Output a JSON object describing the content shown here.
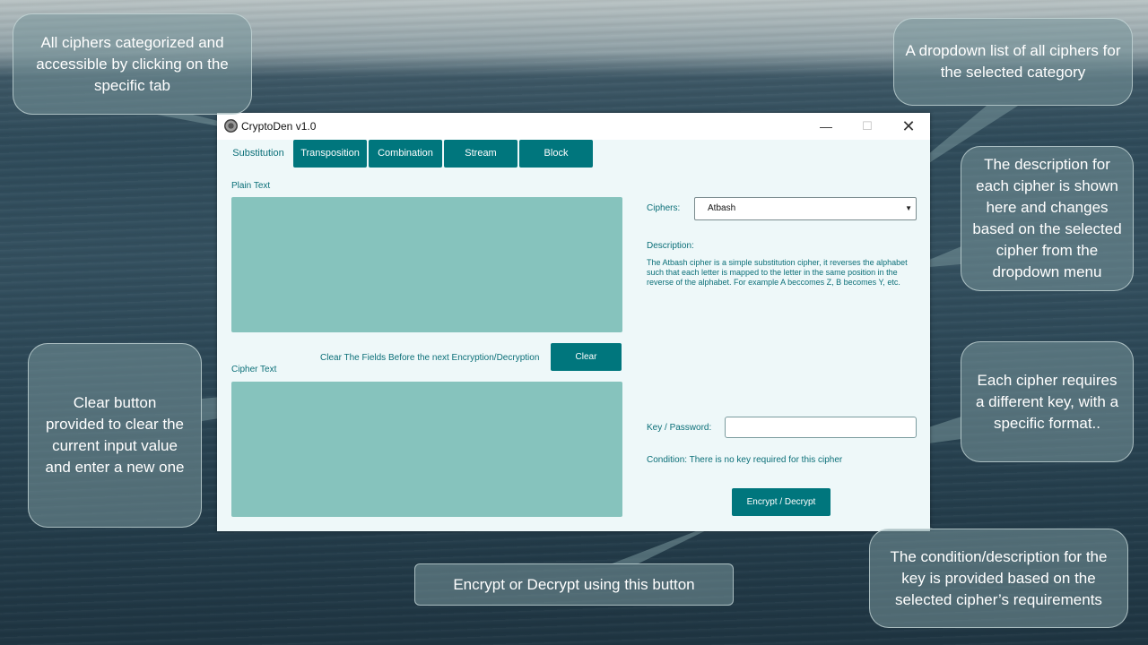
{
  "window": {
    "title": "CryptoDen v1.0",
    "controls": {
      "minimize": "—",
      "maximize": "☐",
      "close": "✕"
    }
  },
  "tabs": [
    {
      "label": "Substitution",
      "active": true
    },
    {
      "label": "Transposition",
      "active": false
    },
    {
      "label": "Combination",
      "active": false
    },
    {
      "label": "Stream",
      "active": false
    },
    {
      "label": "Block",
      "active": false
    }
  ],
  "left": {
    "plain_text_label": "Plain Text",
    "plain_text_value": "",
    "clear_hint": "Clear The Fields Before the next Encryption/Decryption",
    "clear_label": "Clear",
    "cipher_text_label": "Cipher Text",
    "cipher_text_value": ""
  },
  "right": {
    "ciphers_label": "Ciphers:",
    "cipher_selected": "Atbash",
    "description_label": "Description:",
    "description_text": "The Atbash cipher is a simple substitution cipher, it reverses the alphabet such that each letter is mapped to the letter in the same position in the reverse of the alphabet. For example A beccomes Z, B becomes Y, etc.",
    "key_label": "Key / Password:",
    "key_value": "",
    "condition_text": "Condition: There is no key required for this cipher",
    "encrypt_label": "Encrypt / Decrypt"
  },
  "callouts": {
    "tabs": "All ciphers categorized and accessible by clicking on the specific tab",
    "dropdown": "A dropdown list of all ciphers for the selected category",
    "description": "The description for each cipher is shown here and changes based on the selected cipher from the dropdown menu",
    "clear": "Clear button provided to clear the current input value and enter a new one",
    "key": "Each cipher requires a different key, with a specific format..",
    "encrypt": "Encrypt or Decrypt using this button",
    "condition": "The condition/description for the key is provided based on the selected cipher’s requirements"
  },
  "colors": {
    "accent": "#00767d",
    "textarea": "#86c3bd",
    "window_bg": "#eef8f9",
    "label_text": "#0b6f78"
  }
}
